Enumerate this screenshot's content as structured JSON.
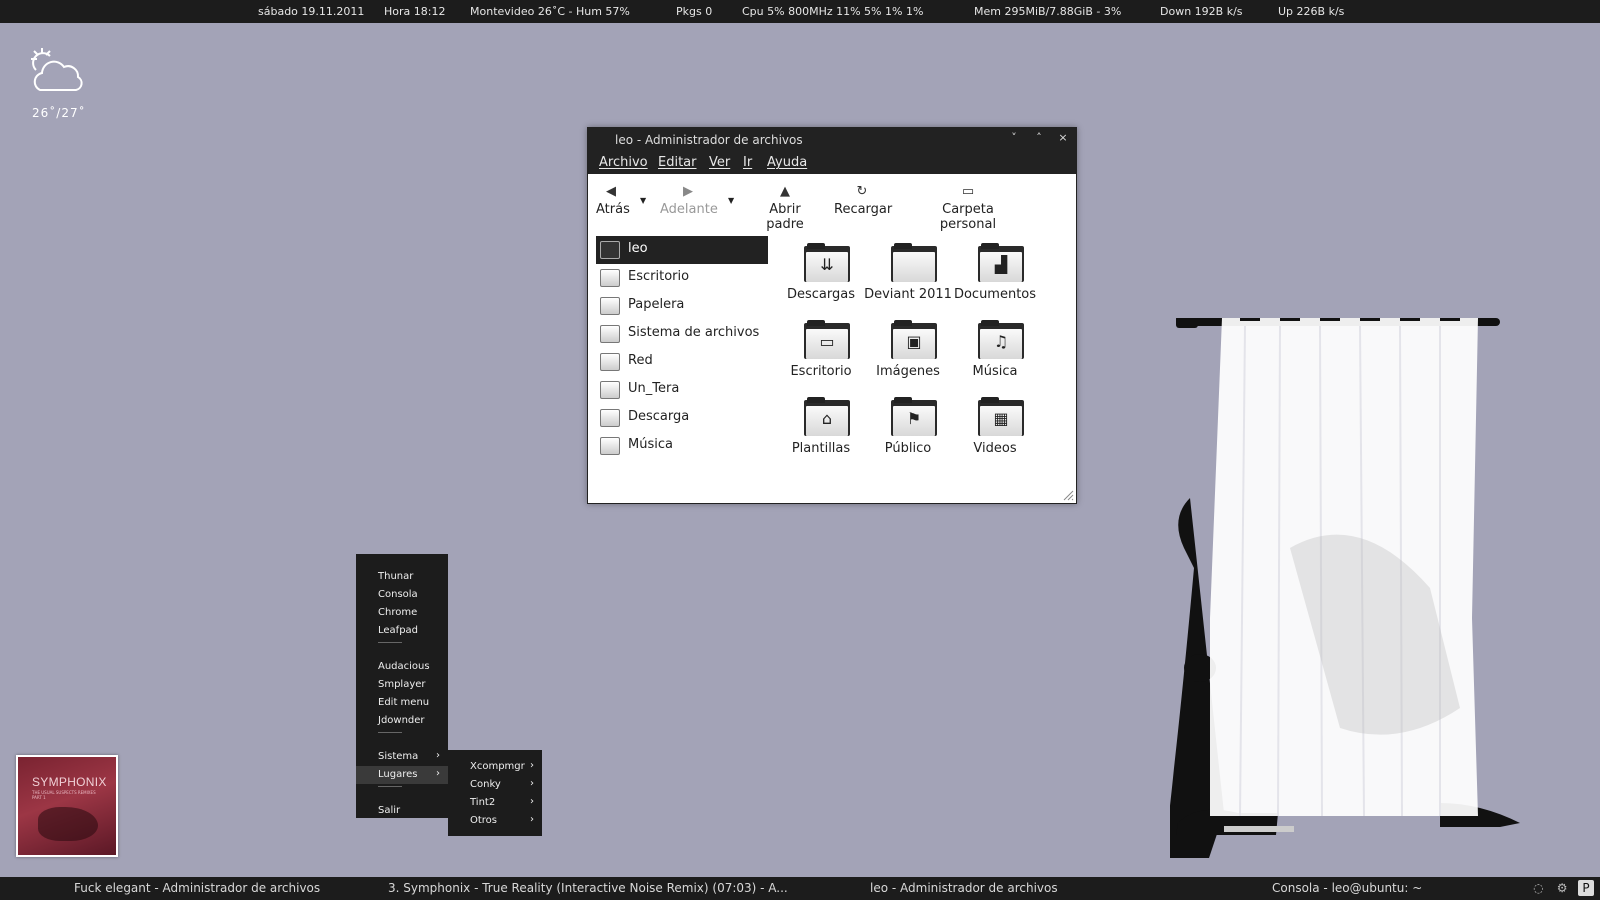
{
  "conky": {
    "date": "sábado 19.11.2011",
    "time": "Hora 18:12",
    "weather": "Montevideo  26˚C -  Hum 57%",
    "pkgs": "Pkgs 0",
    "cpu": "Cpu 5%  800MHz  11% 5% 1%  1%",
    "mem": "Mem 295MiB/7.88GiB - 3%",
    "down": "Down 192B  k/s",
    "up": "Up 226B  k/s"
  },
  "weather_widget": {
    "icon": "cloud-sun-icon",
    "temp": "26˚/27˚"
  },
  "file_manager": {
    "title": "leo - Administrador de archivos",
    "window_buttons": [
      "˅",
      "˄",
      "×"
    ],
    "menu": [
      "Archivo",
      "Editar",
      "Ver",
      "Ir",
      "Ayuda"
    ],
    "toolbar": {
      "back": "Atrás",
      "forward": "Adelante",
      "parent": "Abrir padre",
      "reload": "Recargar",
      "home": "Carpeta personal"
    },
    "sidebar": [
      {
        "label": "leo",
        "icon": "computer-icon",
        "selected": true
      },
      {
        "label": "Escritorio",
        "icon": "desktop-folder-icon"
      },
      {
        "label": "Papelera",
        "icon": "trash-icon"
      },
      {
        "label": "Sistema de archivos",
        "icon": "drive-icon"
      },
      {
        "label": "Red",
        "icon": "network-icon"
      },
      {
        "label": "Un_Tera",
        "icon": "drive-icon"
      },
      {
        "label": "Descarga",
        "icon": "downloads-folder-icon"
      },
      {
        "label": "Música",
        "icon": "music-folder-icon"
      }
    ],
    "folders": [
      {
        "label": "Descargas",
        "icon": "downloads-folder-icon"
      },
      {
        "label": "Deviant 2011",
        "icon": "folder-icon"
      },
      {
        "label": "Documentos",
        "icon": "documents-folder-icon"
      },
      {
        "label": "Escritorio",
        "icon": "desktop-folder-icon"
      },
      {
        "label": "Imágenes",
        "icon": "pictures-folder-icon"
      },
      {
        "label": "Música",
        "icon": "music-folder-icon"
      },
      {
        "label": "Plantillas",
        "icon": "templates-folder-icon"
      },
      {
        "label": "Público",
        "icon": "public-folder-icon"
      },
      {
        "label": "Videos",
        "icon": "videos-folder-icon"
      }
    ]
  },
  "openbox_menu": {
    "items": [
      "Thunar",
      "Consola",
      "Chrome",
      "Leafpad",
      "Audacious",
      "Smplayer",
      "Edit menu",
      "Jdownder",
      "Sistema",
      "Lugares",
      "Salir"
    ],
    "separator": "—",
    "submenu": [
      "Xcompmgr",
      "Conky",
      "Tint2",
      "Otros"
    ],
    "arrow": "›"
  },
  "album": {
    "artist": "SYMPHONIX",
    "subtitle": "THE USUAL SUSPECTS REMIXES PART 1"
  },
  "taskbar": {
    "tasks": [
      "Fuck elegant - Administrador de archivos",
      "3. Symphonix - True Reality (Interactive Noise Remix) (07:03) - A...",
      "leo - Administrador de archivos",
      "Consola - leo@ubuntu: ~"
    ]
  },
  "colors": {
    "desktop": "#a3a3b7",
    "panel": "#1c1c1c",
    "accent": "#222222"
  }
}
